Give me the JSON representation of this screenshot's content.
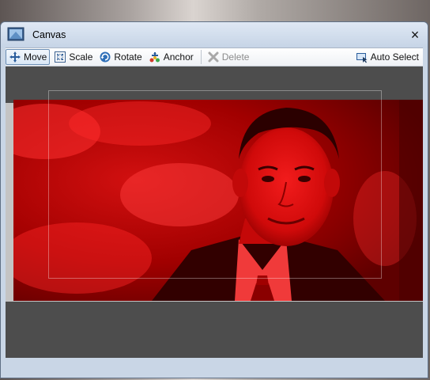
{
  "window": {
    "title": "Canvas",
    "close_symbol": "×"
  },
  "toolbar": {
    "move_label": "Move",
    "scale_label": "Scale",
    "rotate_label": "Rotate",
    "anchor_label": "Anchor",
    "delete_label": "Delete",
    "auto_select_label": "Auto Select"
  },
  "icons": {
    "app": "canvas-window-icon",
    "move": "move-arrows-icon",
    "scale": "scale-box-icon",
    "rotate": "rotate-icon",
    "anchor": "anchor-icon",
    "delete": "delete-x-icon",
    "auto_select": "auto-select-icon",
    "close": "close-icon"
  },
  "canvas": {
    "image_description_color": "#cc0000",
    "background_color": "#4d4d4d",
    "stage_color": "#c4c4c4"
  }
}
